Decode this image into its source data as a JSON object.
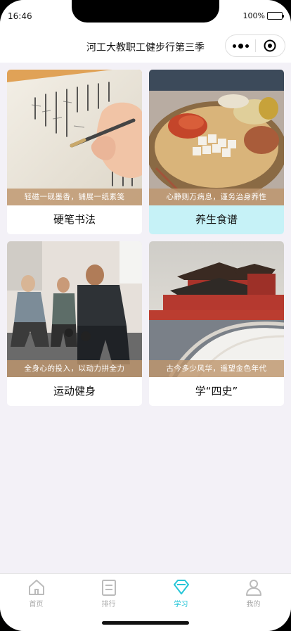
{
  "status_bar": {
    "time": "16:46",
    "battery": "100%"
  },
  "navbar": {
    "title": "河工大教职工健步行第三季"
  },
  "cards": [
    {
      "caption": "轻磁一砚墨香，铺展一纸素笺",
      "label": "硬笔书法",
      "image": "calligraphy-photo"
    },
    {
      "caption": "心静则万病息，谨务治身养性",
      "label": "养生食谱",
      "image": "herbal-medicine-photo",
      "selected": true
    },
    {
      "caption": "全身心的投入，以动力拼全力",
      "label": "运动健身",
      "image": "fitness-class-photo"
    },
    {
      "caption": "古今多少风华，遥望金色年代",
      "label": "学“四史”",
      "image": "forbidden-city-photo"
    }
  ],
  "tabbar": {
    "items": [
      {
        "label": "首页",
        "icon": "home-icon"
      },
      {
        "label": "排行",
        "icon": "ranking-icon"
      },
      {
        "label": "学习",
        "icon": "study-diamond-icon",
        "active": true
      },
      {
        "label": "我的",
        "icon": "profile-icon"
      }
    ]
  },
  "colors": {
    "accent": "#27c6d8",
    "selected_card_bg": "#c6f2f7",
    "page_bg": "#f3f1f7",
    "caption_bg": "#be966e"
  }
}
